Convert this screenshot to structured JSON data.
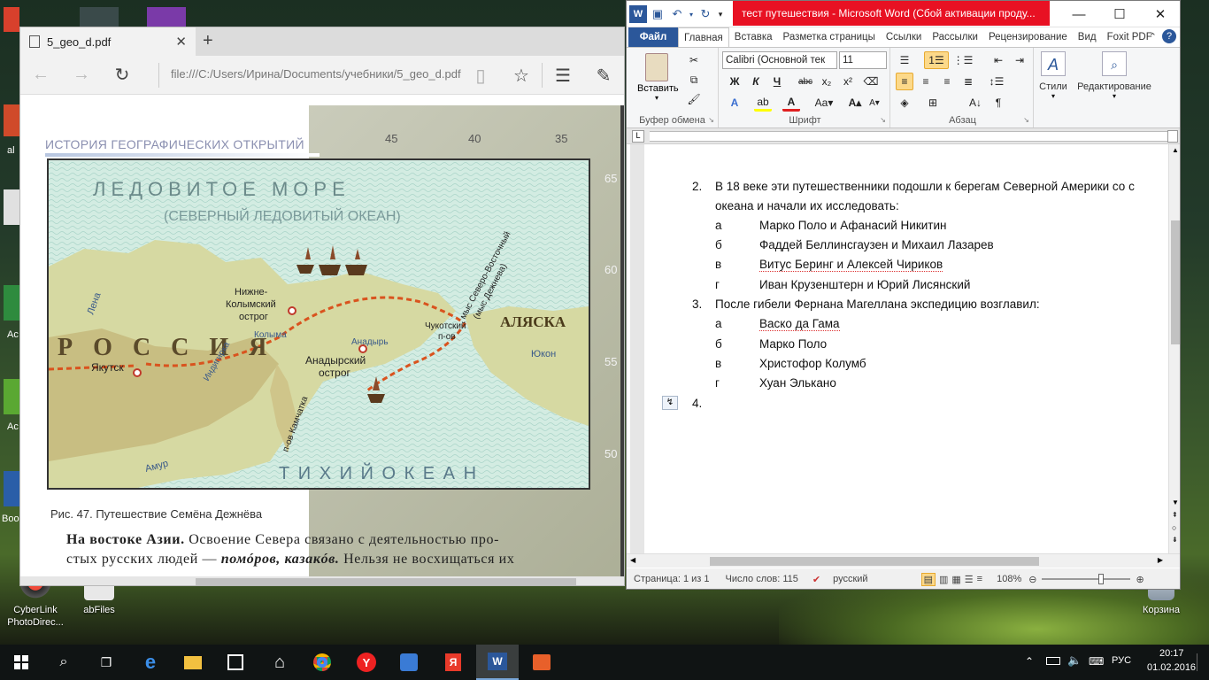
{
  "desktop": {
    "icons": [
      {
        "label": "CyberLink PhotoDirec...",
        "lines": [
          "CyberLink",
          "PhotoDirec..."
        ]
      },
      {
        "label": "abFiles",
        "lines": [
          "abFiles"
        ]
      },
      {
        "label": "Корзина",
        "lines": [
          "Корзина"
        ]
      }
    ],
    "edge_labels": [
      "al",
      "Ac",
      "Ac",
      "Boo"
    ]
  },
  "edge": {
    "tab_title": "5_geo_d.pdf",
    "url": "file:///C:/Users/Ирина/Documents/учебники/5_geo_d.pdf"
  },
  "pdf": {
    "section_header": "ИСТОРИЯ ГЕОГРАФИЧЕСКИХ ОТКРЫТИЙ",
    "map": {
      "sea_title": "ЛЕДОВИТОЕ МОРЕ",
      "sea_subtitle": "(СЕВЕРНЫЙ ЛЕДОВИТЫЙ ОКЕАН)",
      "russia": "Р О С С И Я",
      "pacific": "Т И Х И Й   О К Е А Н",
      "alaska": "АЛЯСКА",
      "lena": "Лена",
      "yakutsk": "Якутск",
      "kolyma_town": [
        "Нижне-",
        "Колымский",
        "острог"
      ],
      "indigirka": "Индигирка",
      "kolyma": "Колыма",
      "anadyr_town": [
        "Анадырский",
        "острог"
      ],
      "anadyr": "Анадырь",
      "chukotka": [
        "Чукотский",
        "п-ов"
      ],
      "kamchatka": "п-ов Камчатка",
      "amur": "Амур",
      "yukon": "Юкон",
      "cape": [
        "мыс Северо-Восточный",
        "(мыс Дежнева)"
      ],
      "lat_labels": [
        "65",
        "60",
        "55",
        "50"
      ],
      "lon_labels": [
        "45",
        "40",
        "35"
      ]
    },
    "caption": "Рис. 47. Путешествие Семёна Дежнёва",
    "text_bold": "На востоке Азии.",
    "text_line1": " Освоение Севера связано с деятельностью про-",
    "text_line2_a": "стых русских людей — ",
    "text_line2_b": "помóров, казакóв.",
    "text_line2_c": " Нельзя не восхищаться их"
  },
  "word": {
    "title": "тест путешествия  -  Microsoft Word (Сбой активации проду...",
    "tabs": [
      "Файл",
      "Главная",
      "Вставка",
      "Разметка страницы",
      "Ссылки",
      "Рассылки",
      "Рецензирование",
      "Вид",
      "Foxit PDF"
    ],
    "active_tab": "Главная",
    "font_name": "Calibri (Основной тек",
    "font_size": "11",
    "paste_label": "Вставить",
    "group_clipboard": "Буфер обмена",
    "group_font": "Шрифт",
    "group_paragraph": "Абзац",
    "styles_label": "Стили",
    "editing_label": "Редактирование",
    "doc": {
      "q2_num": "2.",
      "q2_line1": "В 18 веке эти путешественники подошли к берегам Северной Америки со с",
      "q2_line2": "океана и начали их исследовать:",
      "q2_answers": [
        {
          "letter": "а",
          "text": "Марко Поло и Афанасий Никитин"
        },
        {
          "letter": "б",
          "text": "Фаддей Беллинсгаузен и Михаил Лазарев"
        },
        {
          "letter": "в",
          "text": "Витус Беринг и Алексей Чириков"
        },
        {
          "letter": "г",
          "text": "Иван Крузенштерн и Юрий Лисянский"
        }
      ],
      "q3_num": "3.",
      "q3_line1": "После гибели Фернана Магеллана экспедицию возглавил:",
      "q3_answers": [
        {
          "letter": "а",
          "text": "Васко да Гама"
        },
        {
          "letter": "б",
          "text": "Марко Поло"
        },
        {
          "letter": "в",
          "text": "Христофор Колумб"
        },
        {
          "letter": "г",
          "text": "Хуан Элькано"
        }
      ],
      "q4_num": "4."
    },
    "status": {
      "page": "Страница: 1 из 1",
      "words": "Число слов: 115",
      "language": "русский",
      "zoom": "108%"
    }
  },
  "taskbar": {
    "language": "РУС",
    "time": "20:17",
    "date": "01.02.2016"
  }
}
